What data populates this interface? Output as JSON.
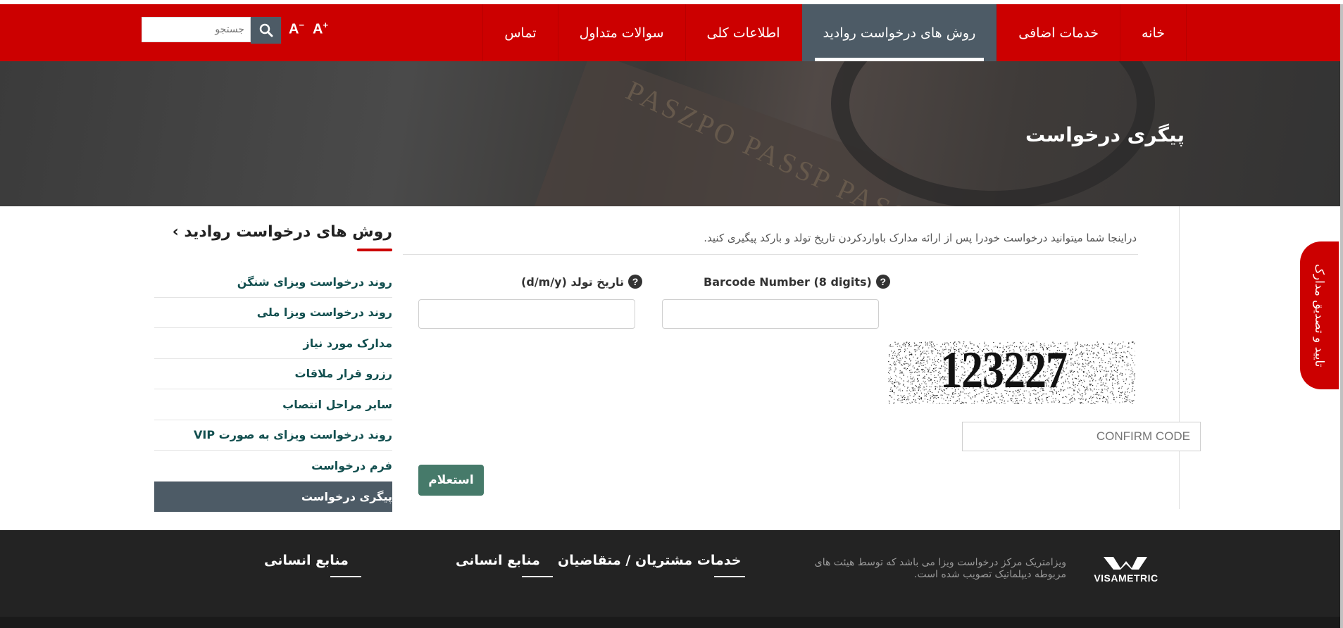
{
  "nav": {
    "items": [
      "خانه",
      "خدمات اضافی",
      "روش های درخواست روادید",
      "اطلاعات کلی",
      "سوالات متداول",
      "تماس"
    ],
    "active_index": 2,
    "search_placeholder": "جستجو",
    "font_decrease": "A",
    "font_decrease_sign": "−",
    "font_increase": "A",
    "font_increase_sign": "+"
  },
  "hero": {
    "title": "پیگری درخواست",
    "bg_text": "PASZPO PASSP PASSE"
  },
  "sidebar": {
    "title": "روش های درخواست روادید ›",
    "items": [
      "روند درخواست ویزای شنگن",
      "روند درخواست ویزا ملی",
      "مدارک مورد نیاز",
      "رزرو قرار ملاقات",
      "سایر مراحل انتصاب",
      "روند درخواست ویزای به صورت VIP",
      "فرم درخواست",
      "پیگری درخواست"
    ],
    "active_index": 7
  },
  "form": {
    "intro": "دراینجا شما میتوانید درخواست خودرا پس از ارائه مدارک باواردکردن تاریخ تولد و بارکد پیگیری کنید.",
    "barcode_label": "Barcode Number (8 digits)",
    "dob_label": "تاریخ تولد (d/m/y)",
    "captcha_text": "123227",
    "confirm_placeholder": "CONFIRM CODE",
    "submit_label": "استعلام"
  },
  "side_tab": {
    "label": "تایید و تصدیق مدارک"
  },
  "footer": {
    "desc": "ویزامتریک مرکز درخواست ویزا می باشد که توسط هیئت های مربوطه دیپلماتیک تصویب شده است.",
    "head_customer": "خدمات مشتریان / متقاضیان",
    "head_hr_1": "منابع انسانی",
    "head_hr_2": "منابع انسانی",
    "logo_text": "VISAMETRIC"
  },
  "colors": {
    "brand_red": "#cc0000",
    "active_slate": "#4d5b66",
    "button_green": "#467a6a",
    "footer_dark": "#232323"
  }
}
